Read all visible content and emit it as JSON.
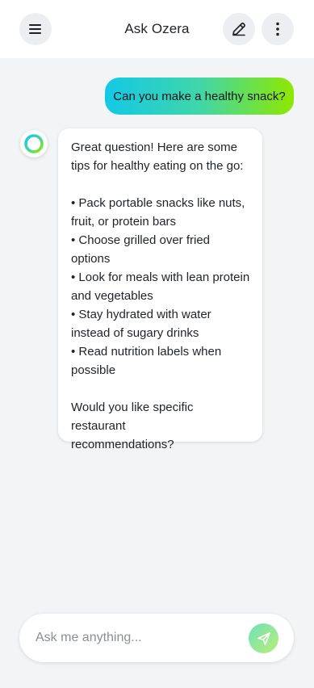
{
  "header": {
    "title": "Ask Ozera",
    "menu_icon": "hamburger-menu-icon",
    "edit_icon": "pencil-edit-icon",
    "more_icon": "more-vertical-icon"
  },
  "chat": {
    "user_message": "Can you make a healthy snack?",
    "assistant_avatar_icon": "ozera-ring-logo",
    "assistant": {
      "intro": [
        "Great question! Here are some",
        "tips for healthy eating on the go:"
      ],
      "tips": [
        [
          "• Pack portable snacks like nuts,",
          "fruit, or protein bars"
        ],
        [
          "• Choose grilled over fried",
          "options"
        ],
        [
          "• Look for meals with lean protein",
          "and vegetables"
        ],
        [
          "• Stay hydrated with water",
          "instead of sugary drinks"
        ],
        [
          "• Read nutrition labels when",
          "possible"
        ]
      ],
      "outro": [
        "Would you like specific restaurant",
        "recommendations?"
      ]
    }
  },
  "composer": {
    "placeholder": "Ask me anything...",
    "value": "",
    "send_icon": "paper-plane-send-icon"
  },
  "colors": {
    "background": "#f3f4f6",
    "header": "#ffffff",
    "gradient_start": "#13c9e6",
    "gradient_end": "#8ee800"
  }
}
